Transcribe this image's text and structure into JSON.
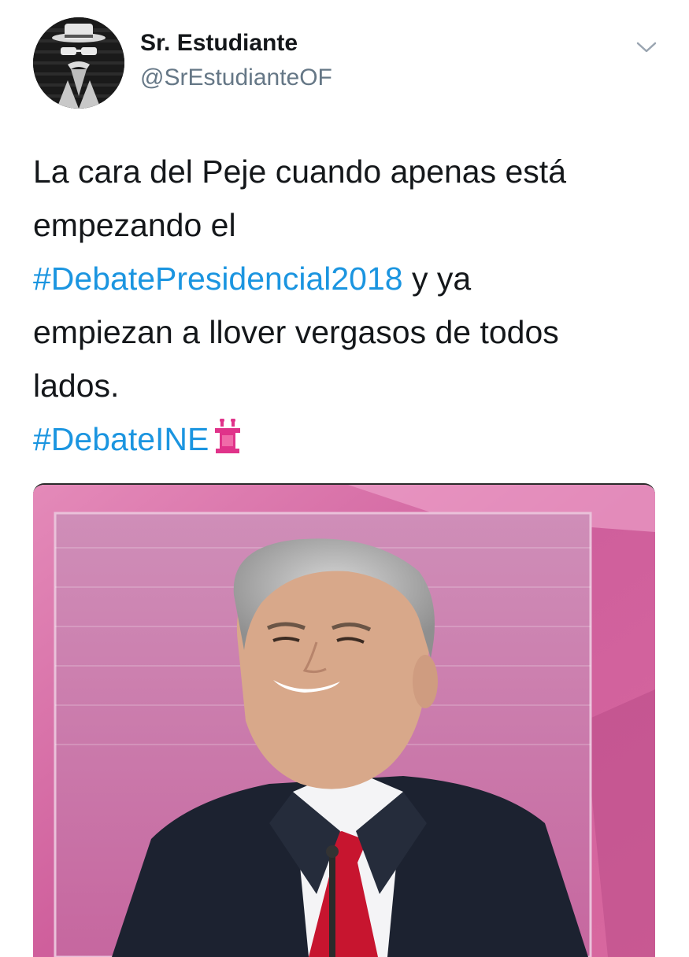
{
  "tweet": {
    "author": {
      "display_name": "Sr. Estudiante",
      "handle": "@SrEstudianteOF",
      "avatar_icon": "masked-figure-avatar"
    },
    "menu_icon": "chevron-down-icon",
    "text_lines": [
      {
        "parts": [
          {
            "text": "La cara del Peje cuando apenas está",
            "type": "text"
          }
        ]
      },
      {
        "parts": [
          {
            "text": "empezando el",
            "type": "text"
          }
        ]
      },
      {
        "parts": [
          {
            "text": "#DebatePresidencial2018",
            "type": "hashtag"
          },
          {
            "text": " y ya",
            "type": "text"
          }
        ]
      },
      {
        "parts": [
          {
            "text": "empiezan a llover vergasos de todos",
            "type": "text"
          }
        ]
      },
      {
        "parts": [
          {
            "text": "lados.",
            "type": "text"
          }
        ]
      },
      {
        "parts": [
          {
            "text": "#DebateINE",
            "type": "hashtag"
          }
        ],
        "emoji": "podium-emoji"
      }
    ],
    "media": {
      "type": "photo",
      "subject": "smiling-man-at-podium"
    },
    "colors": {
      "hashtag": "#1b95e0",
      "text": "#14171a",
      "handle": "#657786",
      "backdrop_pink": "#d65aa0"
    }
  }
}
